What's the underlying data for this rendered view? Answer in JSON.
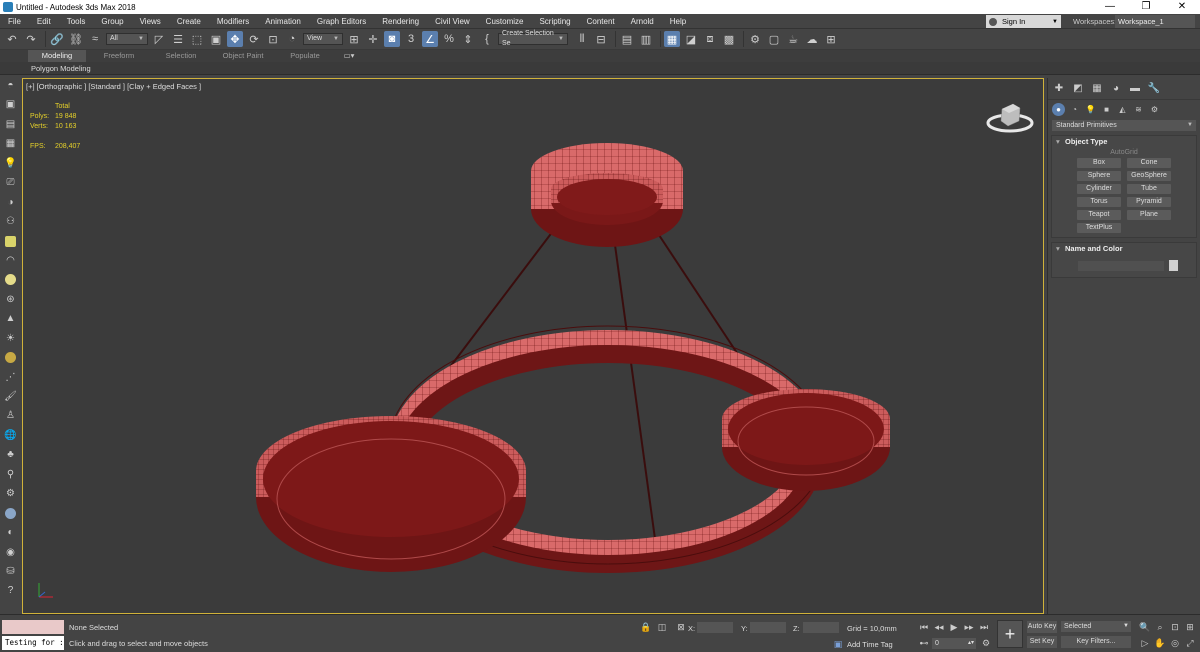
{
  "window": {
    "title": "Untitled - Autodesk 3ds Max 2018",
    "minimize_glyph": "—",
    "maximize_glyph": "❐",
    "close_glyph": "✕"
  },
  "menu": [
    "File",
    "Edit",
    "Tools",
    "Group",
    "Views",
    "Create",
    "Modifiers",
    "Animation",
    "Graph Editors",
    "Rendering",
    "Civil View",
    "Customize",
    "Scripting",
    "Content",
    "Arnold",
    "Help"
  ],
  "account": {
    "sign_in": "Sign In",
    "workspaces_label": "Workspaces:",
    "workspace": "Workspace_1"
  },
  "toolbar": {
    "filter": "All",
    "ref_coord": "View",
    "snap_angle": "3",
    "selection_set": "Create Selection Se"
  },
  "ribbon": {
    "tabs": [
      "Modeling",
      "Freeform",
      "Selection",
      "Object Paint",
      "Populate"
    ],
    "active_tab": "Modeling",
    "panel_label": "Polygon Modeling"
  },
  "viewport": {
    "label": "[+] [Orthographic ] [Standard ] [Clay + Edged Faces ]",
    "stats": {
      "total_label": "Total",
      "polys_label": "Polys:",
      "polys_value": "19 848",
      "verts_label": "Verts:",
      "verts_value": "10 163",
      "fps_label": "FPS:",
      "fps_value": "208,407"
    },
    "object_color": "#8b1e1e",
    "border_color": "#d0b23a"
  },
  "command_panel": {
    "category": "Standard Primitives",
    "object_type": {
      "title": "Object Type",
      "autogrid": "AutoGrid",
      "buttons": [
        "Box",
        "Cone",
        "Sphere",
        "GeoSphere",
        "Cylinder",
        "Tube",
        "Torus",
        "Pyramid",
        "Teapot",
        "Plane",
        "TextPlus"
      ]
    },
    "name_and_color": {
      "title": "Name and Color"
    }
  },
  "status": {
    "selection": "None Selected",
    "prompt": "Click and drag to select and move objects",
    "script_input": "Testing for :",
    "x_label": "X:",
    "y_label": "Y:",
    "z_label": "Z:",
    "grid": "Grid = 10,0mm",
    "add_time_tag": "Add Time Tag",
    "frame": "0",
    "auto_key": "Auto Key",
    "set_key": "Set Key",
    "selected": "Selected",
    "key_filters": "Key Filters..."
  }
}
